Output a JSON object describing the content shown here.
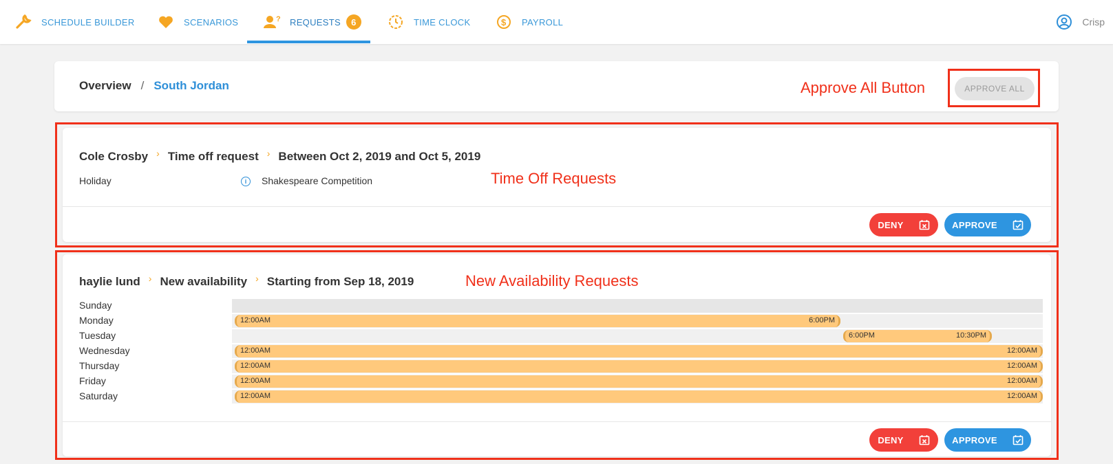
{
  "nav": {
    "items": [
      {
        "label": "SCHEDULE BUILDER",
        "icon": "wrench-icon"
      },
      {
        "label": "SCENARIOS",
        "icon": "heart-icon"
      },
      {
        "label": "REQUESTS",
        "icon": "user-question-icon",
        "badge": "6"
      },
      {
        "label": "TIME CLOCK",
        "icon": "clock-icon"
      },
      {
        "label": "PAYROLL",
        "icon": "dollar-circle-icon"
      }
    ],
    "active": "REQUESTS",
    "user": {
      "name": "Crisp",
      "icon": "user-circle-icon"
    }
  },
  "breadcrumb": {
    "root": "Overview",
    "separator": "/",
    "location": "South Jordan"
  },
  "toolbar": {
    "approve_all_label": "APPROVE ALL"
  },
  "annotations": {
    "approve_all": "Approve All Button",
    "time_off": "Time Off Requests",
    "availability": "New Availability Requests"
  },
  "time_off_request": {
    "employee": "Cole Crosby",
    "type": "Time off request",
    "range": "Between Oct 2, 2019 and Oct 5, 2019",
    "category": "Holiday",
    "note": "Shakespeare Competition",
    "deny_label": "DENY",
    "approve_label": "APPROVE"
  },
  "availability_request": {
    "employee": "haylie lund",
    "type": "New availability",
    "range": "Starting from Sep 18, 2019",
    "days": [
      {
        "day": "Sunday",
        "start": "",
        "end": ""
      },
      {
        "day": "Monday",
        "start": "12:00AM",
        "end": "6:00PM"
      },
      {
        "day": "Tuesday",
        "start": "6:00PM",
        "end": "10:30PM"
      },
      {
        "day": "Wednesday",
        "start": "12:00AM",
        "end": "12:00AM"
      },
      {
        "day": "Thursday",
        "start": "12:00AM",
        "end": "12:00AM"
      },
      {
        "day": "Friday",
        "start": "12:00AM",
        "end": "12:00AM"
      },
      {
        "day": "Saturday",
        "start": "12:00AM",
        "end": "12:00AM"
      }
    ],
    "deny_label": "DENY",
    "approve_label": "APPROVE"
  },
  "colors": {
    "accent_blue": "#2e95e0",
    "orange": "#f5a623",
    "deny_red": "#f2403a",
    "availability_bar": "#ffc97c",
    "annotation_red": "#f0301a"
  }
}
